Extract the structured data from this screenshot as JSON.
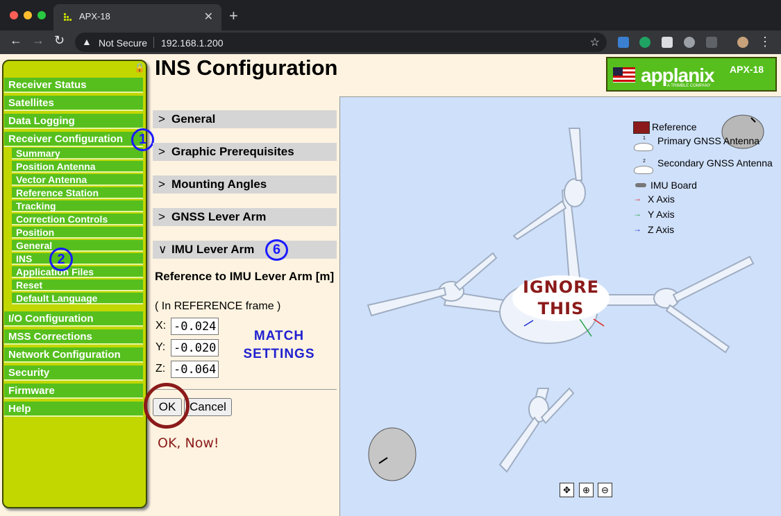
{
  "browser": {
    "tab_title": "APX-18",
    "tab_close": "✕",
    "new_tab": "+",
    "security_label": "Not Secure",
    "url": "192.168.1.200"
  },
  "sidebar": {
    "items_top": [
      "Receiver Status",
      "Satellites",
      "Data Logging",
      "Receiver Configuration"
    ],
    "sub_items": [
      "Summary",
      "Position Antenna",
      "Vector Antenna",
      "Reference Station",
      "Tracking",
      "Correction Controls",
      "Position",
      "General",
      "INS",
      "Application Files",
      "Reset",
      "Default Language"
    ],
    "items_bottom": [
      "I/O Configuration",
      "MSS Corrections",
      "Network Configuration",
      "Security",
      "Firmware",
      "Help"
    ],
    "marker_1": "1",
    "marker_2": "2"
  },
  "page": {
    "title": "INS Configuration",
    "logo_brand": "applanix",
    "logo_sub": "A TRIMBLE COMPANY",
    "logo_model": "APX-18"
  },
  "sections": [
    "General",
    "Graphic Prerequisites",
    "Mounting Angles",
    "GNSS Lever Arm",
    "IMU Lever Arm"
  ],
  "marker_6": "6",
  "form": {
    "title": "Reference to IMU Lever Arm [m]",
    "frame_note": "( In REFERENCE frame )",
    "x_label": "X:",
    "x_value": "-0.024",
    "y_label": "Y:",
    "y_value": "-0.020",
    "z_label": "Z:",
    "z_value": "-0.064",
    "ok_label": "OK",
    "cancel_label": "Cancel"
  },
  "annotations": {
    "match_line1": "MATCH",
    "match_line2": "SETTINGS",
    "ok_now": "OK, Now!",
    "ignore_line1": "IGNORE",
    "ignore_line2": "THIS"
  },
  "viewer": {
    "legend": {
      "reference": "Reference",
      "primary": "Primary GNSS Antenna",
      "primary_num": "1",
      "secondary": "Secondary GNSS Antenna",
      "secondary_num": "2",
      "imu": "IMU Board",
      "x_axis": "X Axis",
      "y_axis": "Y Axis",
      "z_axis": "Z Axis"
    },
    "colors": {
      "reference": "#8b1a1a",
      "x_axis": "#e02020",
      "y_axis": "#20a040",
      "z_axis": "#2030d0"
    }
  },
  "colors": {
    "nav_green": "#56bf1e",
    "sidebar_bg": "#c2d700",
    "page_bg": "#fdf3e0",
    "viewer_bg": "#cfe0fa"
  }
}
